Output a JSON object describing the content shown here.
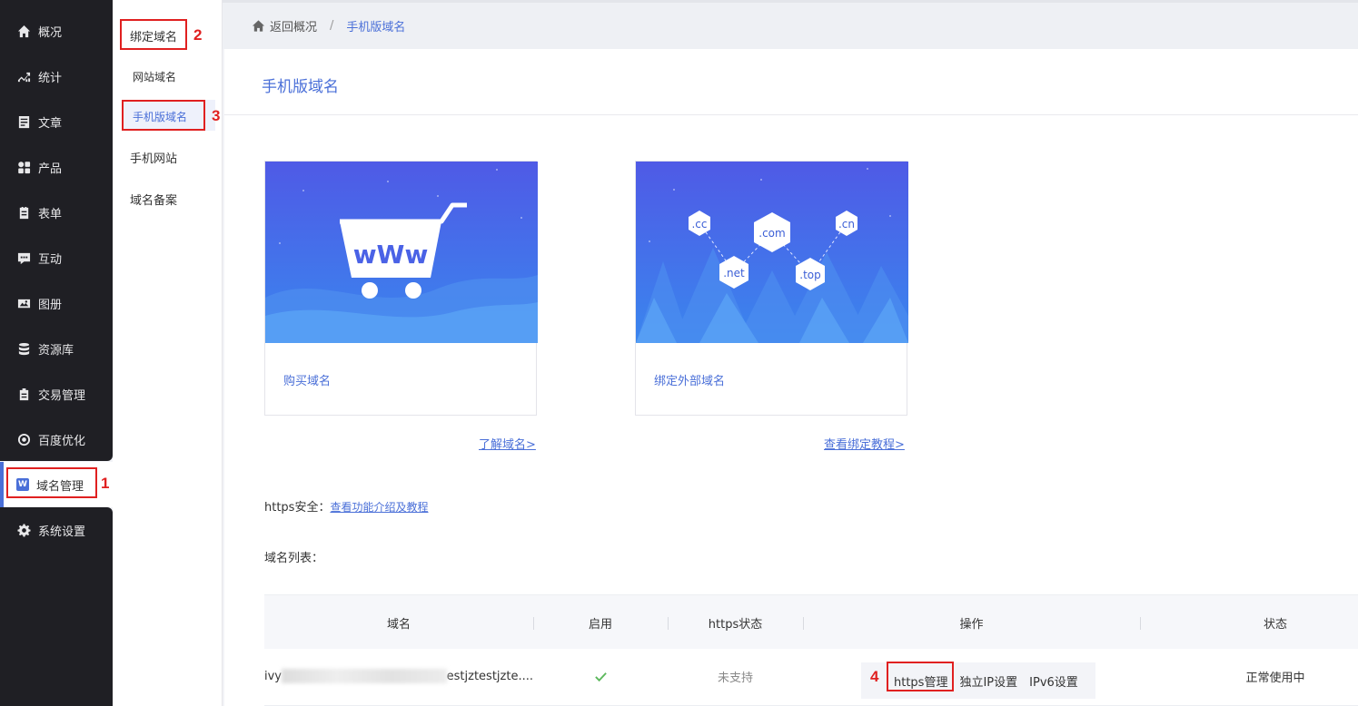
{
  "nav": {
    "items": [
      {
        "label": "概况",
        "icon": "home-icon"
      },
      {
        "label": "统计",
        "icon": "chart-icon"
      },
      {
        "label": "文章",
        "icon": "article-icon"
      },
      {
        "label": "产品",
        "icon": "grid-icon"
      },
      {
        "label": "表单",
        "icon": "form-icon"
      },
      {
        "label": "互动",
        "icon": "chat-icon"
      },
      {
        "label": "图册",
        "icon": "album-icon"
      },
      {
        "label": "资源库",
        "icon": "database-icon"
      },
      {
        "label": "交易管理",
        "icon": "trade-icon"
      },
      {
        "label": "百度优化",
        "icon": "target-icon"
      },
      {
        "label": "域名管理",
        "icon": "domain-icon",
        "icon_glyph": "W"
      },
      {
        "label": "系统设置",
        "icon": "gear-icon"
      }
    ]
  },
  "subnav": {
    "group": "绑定域名",
    "children": [
      "网站域名",
      "手机版域名"
    ],
    "others": [
      "手机网站",
      "域名备案"
    ]
  },
  "annotations": [
    "1",
    "2",
    "3",
    "4"
  ],
  "breadcrumb": {
    "back": "返回概况",
    "separator": "/",
    "current": "手机版域名"
  },
  "page": {
    "title": "手机版域名"
  },
  "cards": [
    {
      "label": "购买域名",
      "link": "了解域名>",
      "banner_text": "wWw"
    },
    {
      "label": "绑定外部域名",
      "link": "查看绑定教程>",
      "tlds": [
        ".cc",
        ".com",
        ".cn",
        ".net",
        ".top"
      ]
    }
  ],
  "https": {
    "label": "https安全：",
    "link": "查看功能介绍及教程"
  },
  "list": {
    "label": "域名列表："
  },
  "table": {
    "headers": [
      "域名",
      "启用",
      "https状态",
      "操作",
      "状态"
    ],
    "rows": [
      {
        "domain_prefix": "ivy",
        "domain_suffix": "estjztestjzte....",
        "https_status": "未支持",
        "ops": [
          "https管理",
          "独立IP设置",
          "IPv6设置"
        ],
        "status": "正常使用中"
      }
    ]
  },
  "colors": {
    "accent": "#4a6fd8",
    "nav_bg": "#1f1f24",
    "annotation": "#e02020",
    "check": "#5cb85c"
  }
}
